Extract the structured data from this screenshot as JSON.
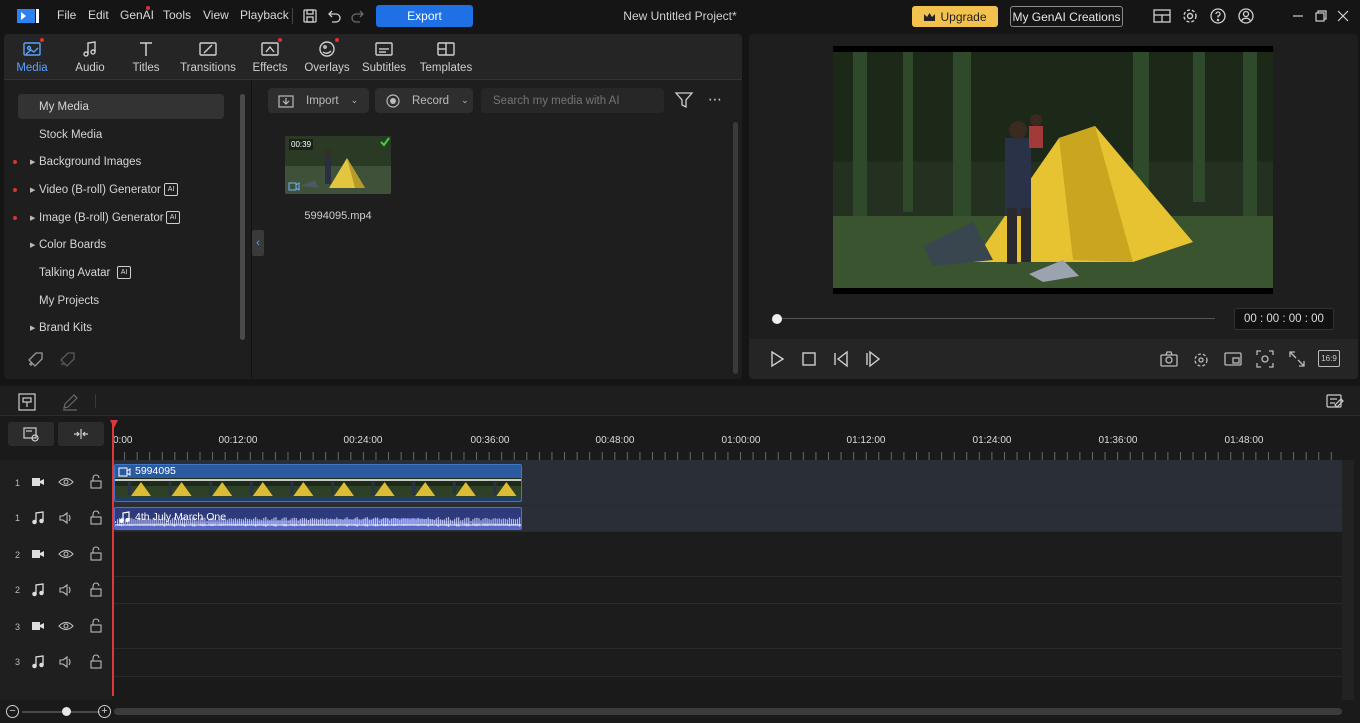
{
  "titlebar": {
    "menus": [
      "File",
      "Edit",
      "GenAI",
      "Tools",
      "View",
      "Playback"
    ],
    "export_label": "Export",
    "project_title": "New Untitled Project*",
    "upgrade_label": "Upgrade",
    "genai_creations_label": "My GenAI Creations"
  },
  "library": {
    "tabs": [
      {
        "label": "Media",
        "icon": "media-icon"
      },
      {
        "label": "Audio",
        "icon": "music-note-icon"
      },
      {
        "label": "Titles",
        "icon": "title-t-icon"
      },
      {
        "label": "Transitions",
        "icon": "transitions-icon"
      },
      {
        "label": "Effects",
        "icon": "effects-icon"
      },
      {
        "label": "Overlays",
        "icon": "overlays-icon"
      },
      {
        "label": "Subtitles",
        "icon": "subtitles-icon"
      },
      {
        "label": "Templates",
        "icon": "templates-icon"
      }
    ],
    "sidebar": [
      {
        "label": "My Media"
      },
      {
        "label": "Stock Media"
      },
      {
        "label": "Background Images"
      },
      {
        "label": "Video (B-roll) Generator"
      },
      {
        "label": "Image (B-roll) Generator"
      },
      {
        "label": "Color Boards"
      },
      {
        "label": "Talking Avatar"
      },
      {
        "label": "My Projects"
      },
      {
        "label": "Brand Kits"
      }
    ],
    "import_label": "Import",
    "record_label": "Record",
    "search_placeholder": "Search my media with AI",
    "media_items": [
      {
        "name": "5994095.mp4",
        "duration": "00:39"
      }
    ]
  },
  "preview": {
    "timecode": "00 : 00 : 00 : 00",
    "aspect": "16:9"
  },
  "timeline": {
    "ruler": [
      "0:00",
      "00:12:00",
      "00:24:00",
      "00:36:00",
      "00:48:00",
      "01:00:00",
      "01:12:00",
      "01:24:00",
      "01:36:00",
      "01:48:00"
    ],
    "tracks": [
      {
        "num": "1",
        "type": "video"
      },
      {
        "num": "1",
        "type": "audio"
      },
      {
        "num": "2",
        "type": "video"
      },
      {
        "num": "2",
        "type": "audio"
      },
      {
        "num": "3",
        "type": "video"
      },
      {
        "num": "3",
        "type": "audio"
      }
    ],
    "video_clip_title": "5994095",
    "audio_clip_title": "4th July March One"
  },
  "colors": {
    "accent": "#1f6fe5",
    "upgrade": "#f2c14e",
    "playhead": "#e03838"
  }
}
